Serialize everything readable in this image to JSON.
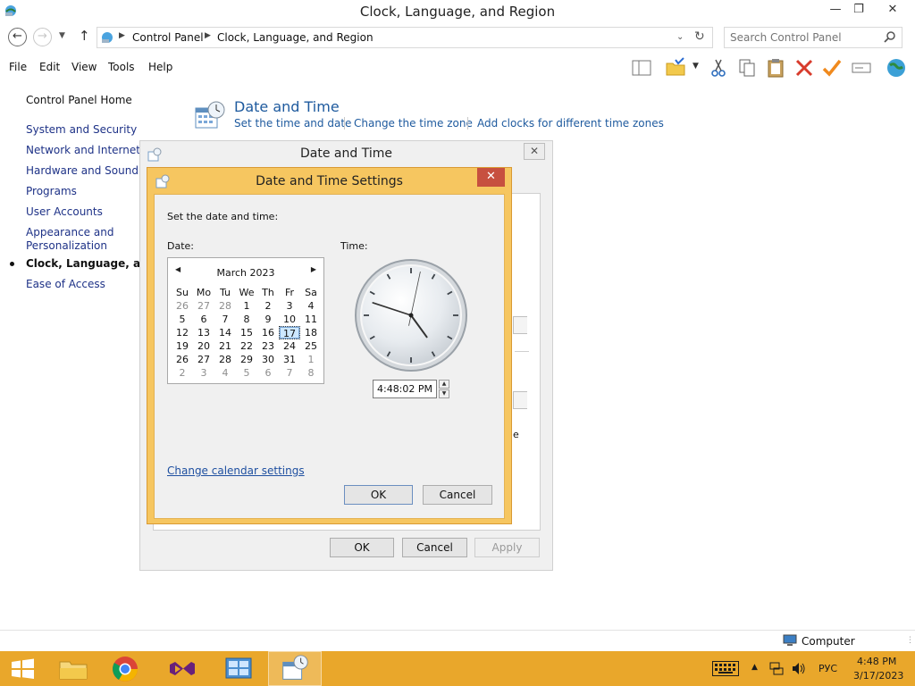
{
  "window": {
    "title": "Clock, Language, and Region",
    "minimize": "—",
    "restore": "❐",
    "close": "✕"
  },
  "address": {
    "crumbs": [
      "Control Panel",
      "Clock, Language, and Region"
    ],
    "search_placeholder": "Search Control Panel"
  },
  "menu": {
    "items": [
      "File",
      "Edit",
      "View",
      "Tools",
      "Help"
    ]
  },
  "left_nav": {
    "home": "Control Panel Home",
    "items": [
      "System and Security",
      "Network and Internet",
      "Hardware and Sound",
      "Programs",
      "User Accounts",
      "Appearance and",
      "Personalization",
      "Clock, Language, and R",
      "Ease of Access"
    ]
  },
  "section": {
    "heading": "Date and Time",
    "links": [
      "Set the time and date",
      "Change the time zone",
      "Add clocks for different time zones"
    ]
  },
  "dialog_back": {
    "title": "Date and Time",
    "partial_text": "e",
    "ok": "OK",
    "cancel": "Cancel",
    "apply": "Apply"
  },
  "dialog_settings": {
    "title": "Date and Time Settings",
    "instruction": "Set the date and time:",
    "date_label": "Date:",
    "time_label": "Time:",
    "calendar": {
      "month": "March 2023",
      "weekdays": [
        "Su",
        "Mo",
        "Tu",
        "We",
        "Th",
        "Fr",
        "Sa"
      ],
      "weeks": [
        [
          "26",
          "27",
          "28",
          "1",
          "2",
          "3",
          "4"
        ],
        [
          "5",
          "6",
          "7",
          "8",
          "9",
          "10",
          "11"
        ],
        [
          "12",
          "13",
          "14",
          "15",
          "16",
          "17",
          "18"
        ],
        [
          "19",
          "20",
          "21",
          "22",
          "23",
          "24",
          "25"
        ],
        [
          "26",
          "27",
          "28",
          "29",
          "30",
          "31",
          "1"
        ],
        [
          "2",
          "3",
          "4",
          "5",
          "6",
          "7",
          "8"
        ]
      ],
      "selected_day": "17"
    },
    "time_value": "4:48:02 PM",
    "clock": {
      "hour": 4,
      "minute": 48,
      "second": 2
    },
    "calendar_settings_link": "Change calendar settings",
    "ok": "OK",
    "cancel": "Cancel"
  },
  "status_bar": {
    "location": "Computer"
  },
  "taskbar": {
    "language": "РУС",
    "time": "4:48 PM",
    "date": "3/17/2023",
    "accent": "#e9a72b"
  }
}
